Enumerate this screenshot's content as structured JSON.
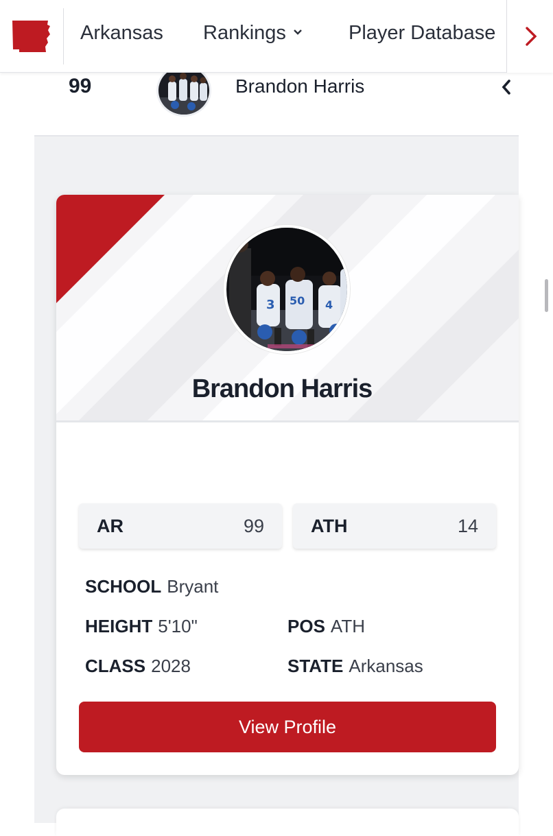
{
  "nav": {
    "state": "Arkansas",
    "rankings": "Rankings",
    "player_database": "Player Database",
    "logo_icon": "arkansas-state-shape-icon",
    "next_icon": "chevron-right-icon"
  },
  "rank_row": {
    "rank": "99",
    "name": "Brandon Harris",
    "caret_icon": "chevron-left-icon"
  },
  "player": {
    "name": "Brandon Harris",
    "stats": [
      {
        "label": "AR",
        "value": "99"
      },
      {
        "label": "ATH",
        "value": "14"
      }
    ],
    "school_label": "SCHOOL",
    "school": "Bryant",
    "height_label": "HEIGHT",
    "height": "5'10\"",
    "pos_label": "POS",
    "pos": "ATH",
    "class_label": "CLASS",
    "class": "2028",
    "state_label": "STATE",
    "state": "Arkansas",
    "button": "View Profile"
  },
  "colors": {
    "brand_red": "#be1b22",
    "panel_gray": "#f0f1f3"
  }
}
